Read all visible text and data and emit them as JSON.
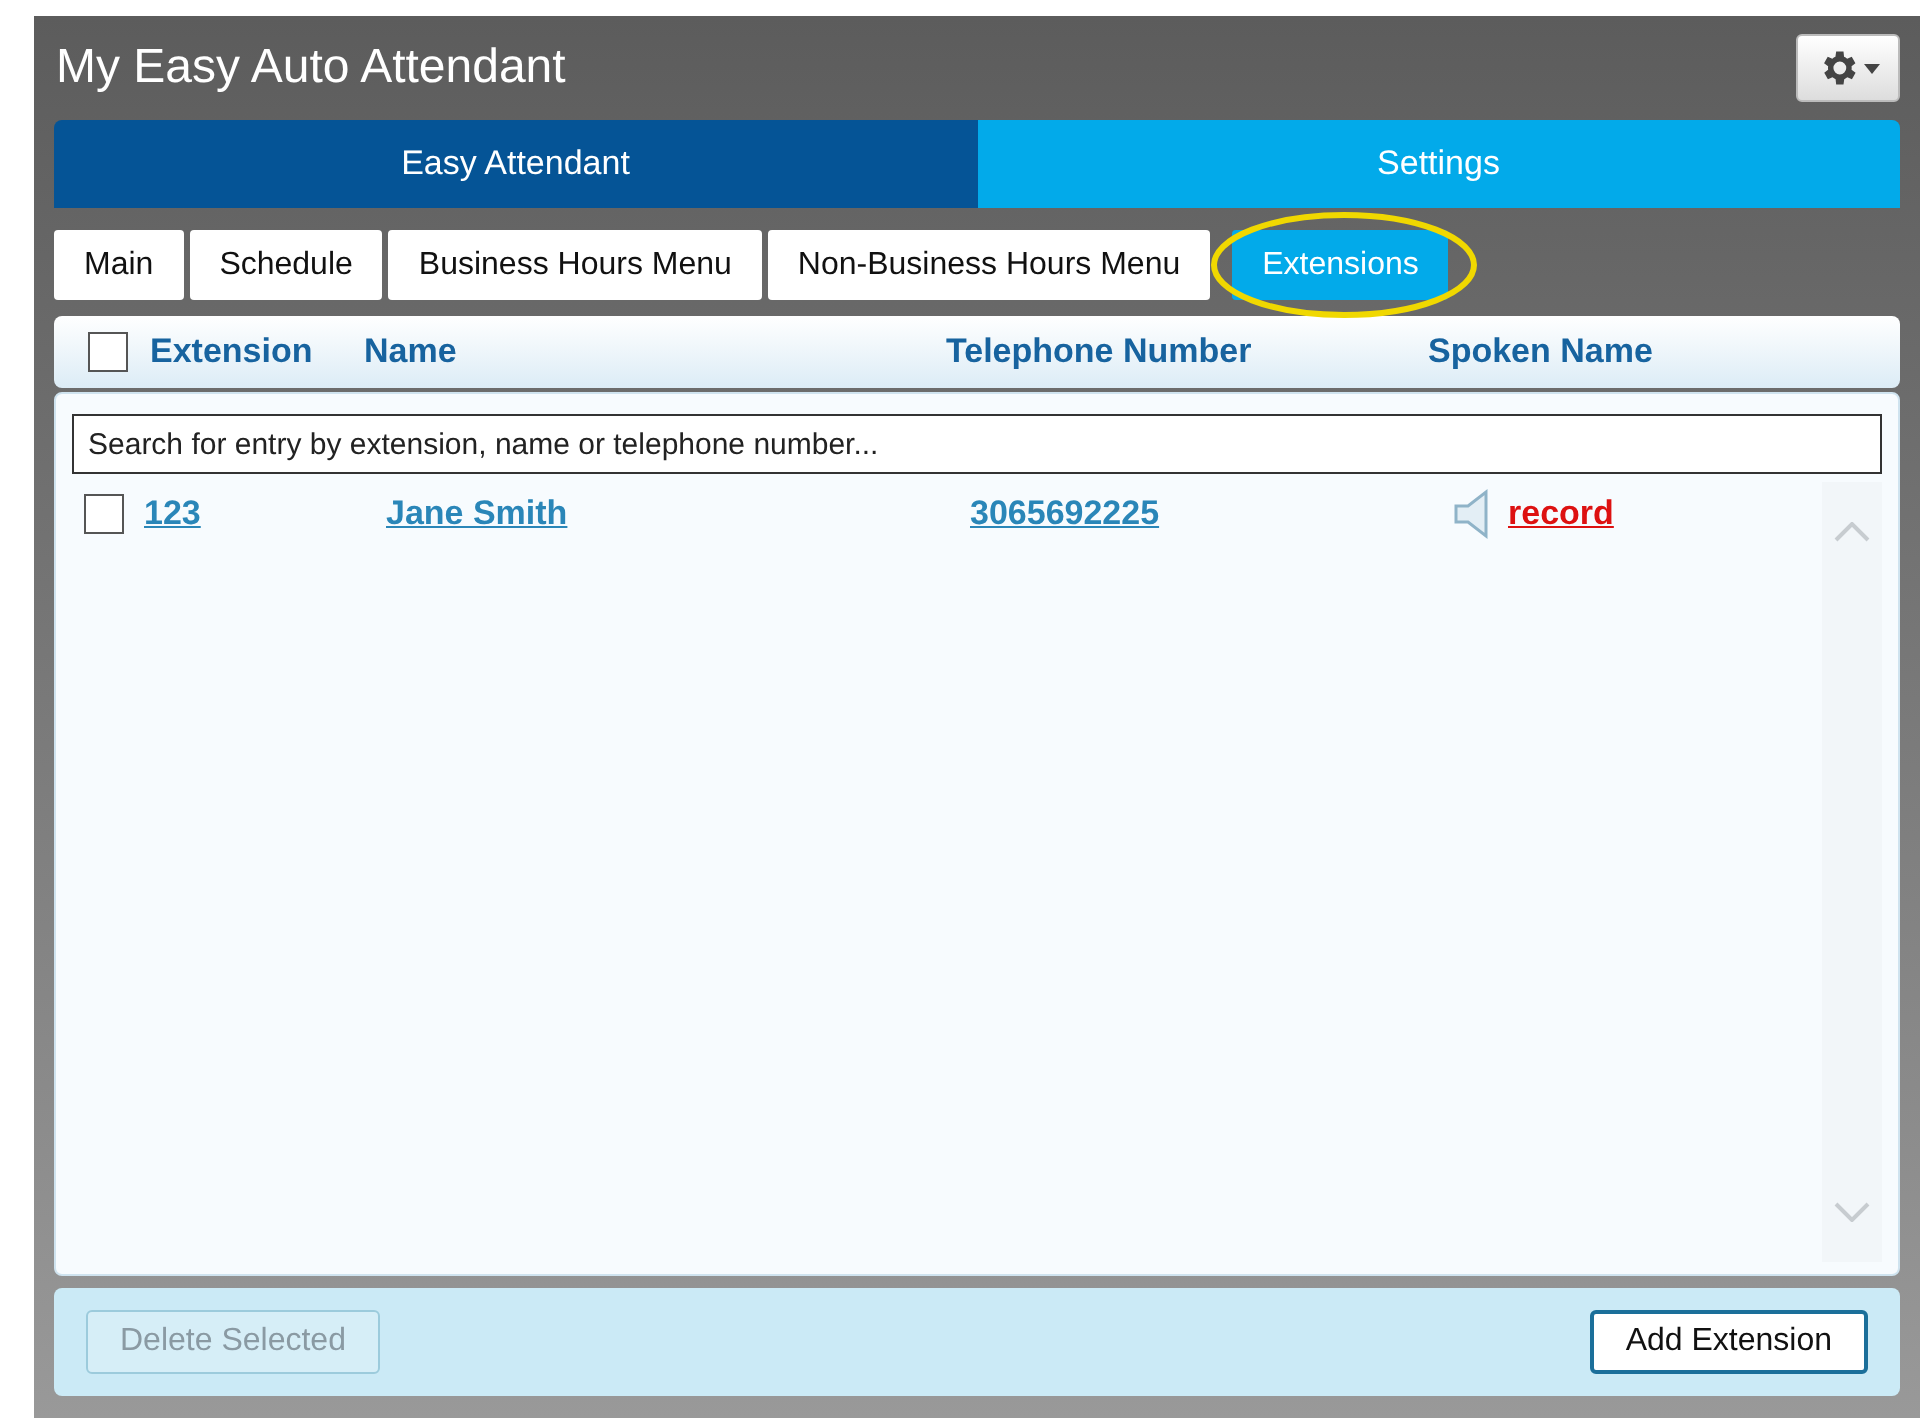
{
  "window": {
    "title": "My Easy Auto Attendant"
  },
  "main_tabs": [
    {
      "label": "Easy Attendant",
      "selected": true
    },
    {
      "label": "Settings",
      "selected": false
    }
  ],
  "sub_tabs": [
    {
      "label": "Main",
      "selected": false,
      "highlighted": false
    },
    {
      "label": "Schedule",
      "selected": false,
      "highlighted": false
    },
    {
      "label": "Business Hours Menu",
      "selected": false,
      "highlighted": false
    },
    {
      "label": "Non-Business Hours Menu",
      "selected": false,
      "highlighted": false
    },
    {
      "label": "Extensions",
      "selected": true,
      "highlighted": true
    }
  ],
  "table": {
    "select_all": {
      "checked": false
    },
    "columns": [
      "Extension",
      "Name",
      "Telephone Number",
      "Spoken Name"
    ],
    "search": {
      "placeholder": "Search for entry by extension, name or telephone number..."
    },
    "rows": [
      {
        "checked": false,
        "extension": "123",
        "name": "Jane Smith",
        "telephone": "3065692225",
        "spoken_name": "record"
      }
    ]
  },
  "buttons": [
    {
      "label": "Delete Selected",
      "disabled": true
    },
    {
      "label": "Add Extension",
      "disabled": false
    }
  ]
}
